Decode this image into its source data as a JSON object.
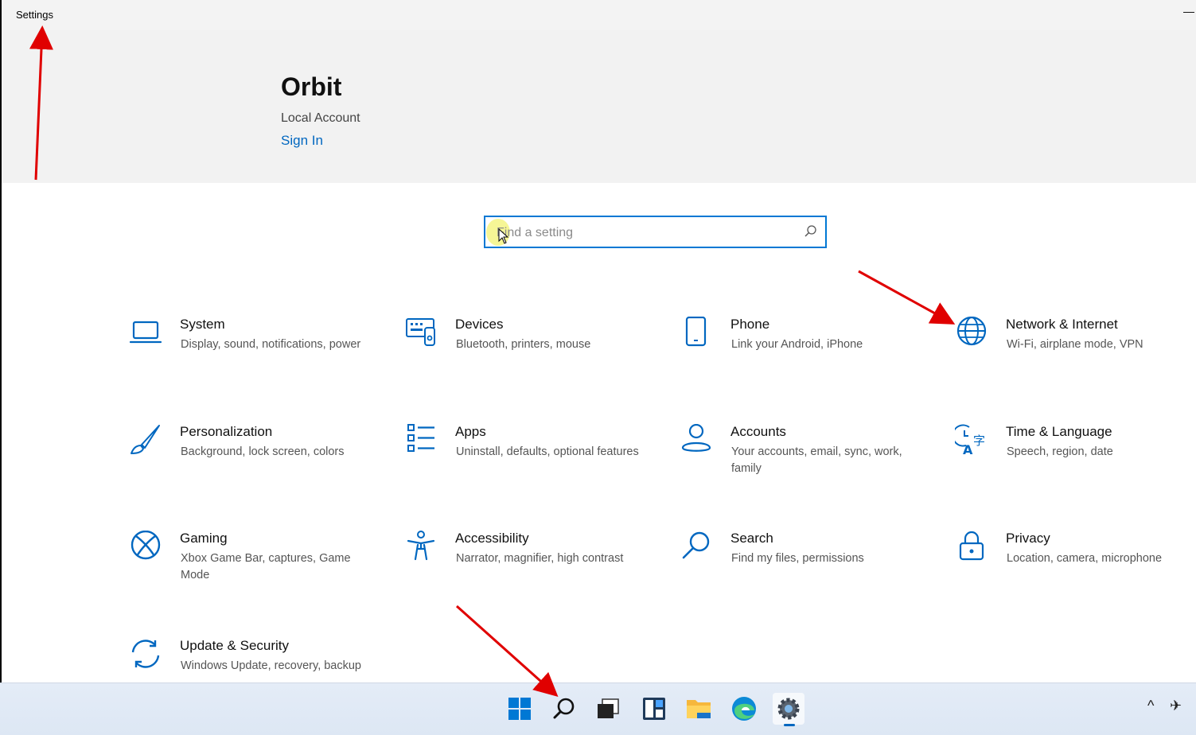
{
  "window": {
    "title": "Settings",
    "minimize_glyph": "—"
  },
  "header": {
    "user_name": "Orbit",
    "account_type": "Local Account",
    "sign_in": "Sign In"
  },
  "search": {
    "placeholder": "Find a setting",
    "icon": "search-icon"
  },
  "accent_color": "#0067c0",
  "tiles": [
    {
      "title": "System",
      "subtitle": "Display, sound, notifications, power",
      "icon": "laptop-icon"
    },
    {
      "title": "Devices",
      "subtitle": "Bluetooth, printers, mouse",
      "icon": "devices-icon"
    },
    {
      "title": "Phone",
      "subtitle": "Link your Android, iPhone",
      "icon": "phone-icon"
    },
    {
      "title": "Network & Internet",
      "subtitle": "Wi-Fi, airplane mode, VPN",
      "icon": "globe-icon"
    },
    {
      "title": "Personalization",
      "subtitle": "Background, lock screen, colors",
      "icon": "brush-icon"
    },
    {
      "title": "Apps",
      "subtitle": "Uninstall, defaults, optional features",
      "icon": "apps-list-icon"
    },
    {
      "title": "Accounts",
      "subtitle": "Your accounts, email, sync, work, family",
      "icon": "person-icon"
    },
    {
      "title": "Time & Language",
      "subtitle": "Speech, region, date",
      "icon": "time-language-icon"
    },
    {
      "title": "Gaming",
      "subtitle": "Xbox Game Bar, captures, Game Mode",
      "icon": "xbox-icon"
    },
    {
      "title": "Accessibility",
      "subtitle": "Narrator, magnifier, high contrast",
      "icon": "accessibility-icon"
    },
    {
      "title": "Search",
      "subtitle": "Find my files, permissions",
      "icon": "search-icon"
    },
    {
      "title": "Privacy",
      "subtitle": "Location, camera, microphone",
      "icon": "lock-icon"
    },
    {
      "title": "Update & Security",
      "subtitle": "Windows Update, recovery, backup",
      "icon": "update-icon"
    }
  ],
  "taskbar": {
    "items": [
      "start-icon",
      "search-icon",
      "task-view-icon",
      "widgets-icon",
      "file-explorer-icon",
      "edge-icon",
      "settings-icon"
    ],
    "active": "settings-icon",
    "tray": {
      "chevron": "^",
      "airplane": "✈"
    }
  },
  "annotation_arrow_color": "#e00000"
}
